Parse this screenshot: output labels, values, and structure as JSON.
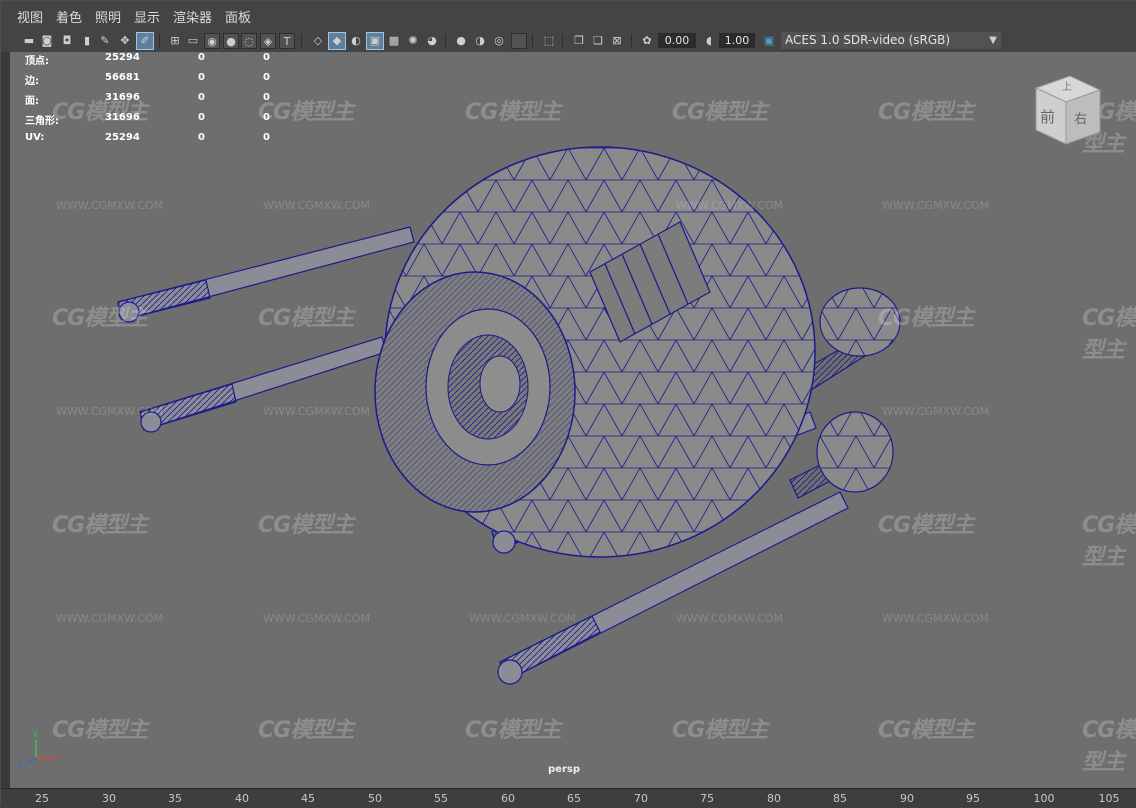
{
  "menu": [
    "视图",
    "着色",
    "照明",
    "显示",
    "渲染器",
    "面板"
  ],
  "toolbar": {
    "icons": [
      "camera-icon",
      "camera-attributes-icon",
      "bookmark-icon",
      "image-plane-icon",
      "grid-icon",
      "film-gate-icon",
      "resolution-gate-icon",
      "safe-area-icon",
      "field-chart-icon",
      "textured-icon",
      "wireframe-icon",
      "smooth-shade-icon",
      "wireframe-on-shaded-icon",
      "xray-icon",
      "lighting-icon",
      "shadows-icon",
      "ambient-occlusion-icon",
      "motion-blur-icon",
      "antialiasing-icon",
      "isolate-select-icon",
      "highlight-icon",
      "exposure-icon",
      "gamma-icon",
      "color-management-icon"
    ],
    "exposure_value": "0.00",
    "gamma_value": "1.00",
    "color_space": "ACES 1.0 SDR-video (sRGB)"
  },
  "hud": {
    "rows": [
      {
        "label": "顶点:",
        "v1": "25294",
        "v2": "0",
        "v3": "0"
      },
      {
        "label": "边:",
        "v1": "56681",
        "v2": "0",
        "v3": "0"
      },
      {
        "label": "面:",
        "v1": "31696",
        "v2": "0",
        "v3": "0"
      },
      {
        "label": "三角形:",
        "v1": "31696",
        "v2": "0",
        "v3": "0"
      },
      {
        "label": "UV:",
        "v1": "25294",
        "v2": "0",
        "v3": "0"
      }
    ]
  },
  "viewcube": {
    "top": "上",
    "front": "前",
    "right": "右"
  },
  "watermark": {
    "logo": "CG模型主",
    "url": "WWW.CGMXW.COM"
  },
  "camera_name": "persp",
  "axis": {
    "x": "x",
    "y": "y",
    "z": "z"
  },
  "timeline_ticks": [
    "25",
    "30",
    "35",
    "40",
    "45",
    "50",
    "55",
    "60",
    "65",
    "70",
    "75",
    "80",
    "85",
    "90",
    "95",
    "100",
    "105"
  ],
  "colors": {
    "wire": "#1a1a8c",
    "viewport_bg": "#6e6e6e",
    "accent": "#4aa0c8"
  }
}
